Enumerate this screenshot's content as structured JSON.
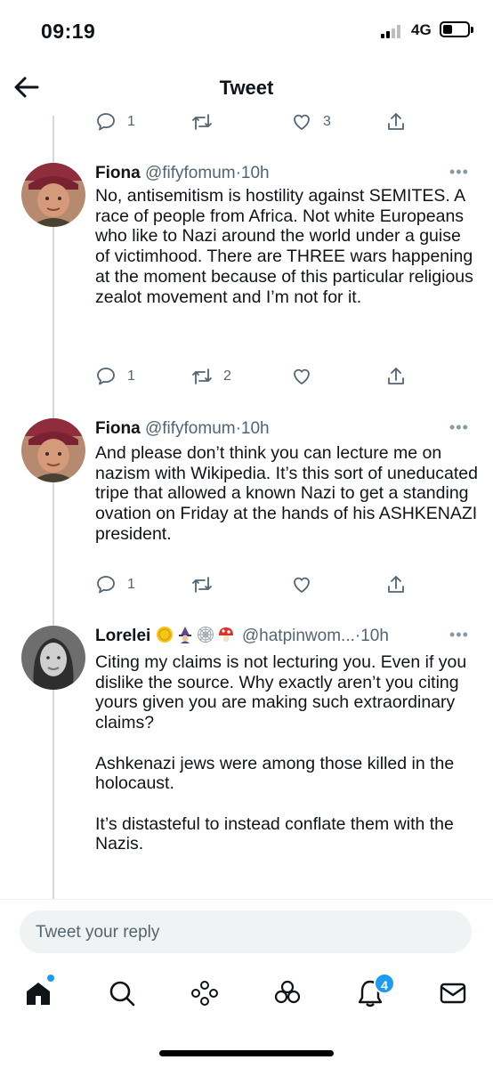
{
  "status_bar": {
    "time": "09:19",
    "network": "4G"
  },
  "header": {
    "title": "Tweet"
  },
  "top_actions": {
    "reply_count": "1",
    "retweet_count": "",
    "like_count": "3"
  },
  "tweets": [
    {
      "name": "Fiona",
      "handle": "@fifyfomum",
      "separator": "·",
      "time": "10h",
      "text": "No, antisemitism is hostility against SEMITES. A race of people from Africa. Not white Europeans who like to Nazi around the world under a guise of victimhood. There are THREE wars happening at the moment because of this particular religious zealot movement and I’m not for it.",
      "reply_count": "1",
      "retweet_count": "2",
      "like_count": ""
    },
    {
      "name": "Fiona",
      "handle": "@fifyfomum",
      "separator": "·",
      "time": "10h",
      "text": "And please don’t think you can lecture me on nazism with Wikipedia. It’s this sort of uneducated tripe that allowed a known Nazi to get a standing ovation on Friday at the hands of his ASHKENAZI president.",
      "reply_count": "1",
      "retweet_count": "",
      "like_count": ""
    },
    {
      "name": "Lorelei",
      "name_emojis": [
        "coin",
        "witch",
        "spider-web",
        "mushroom"
      ],
      "handle": "@hatpinwom...",
      "separator": "·",
      "time": "10h",
      "paragraphs": [
        "Citing my claims is not lecturing you. Even if you dislike the source. Why exactly aren’t you citing yours given you are making such extraordinary claims?",
        "Ashkenazi jews were among those killed in the holocaust.",
        "It’s distasteful to instead conflate them with the Nazis."
      ]
    }
  ],
  "reply": {
    "placeholder": "Tweet your reply"
  },
  "tabbar": {
    "items": [
      "home-icon",
      "search-icon",
      "spaces-icon",
      "communities-icon",
      "notifications-icon",
      "messages-icon"
    ],
    "notifications_badge": "4"
  },
  "colors": {
    "accent": "#1d9bf0",
    "muted": "#536471",
    "text": "#0f1419",
    "thread_line": "#cfd9de"
  }
}
